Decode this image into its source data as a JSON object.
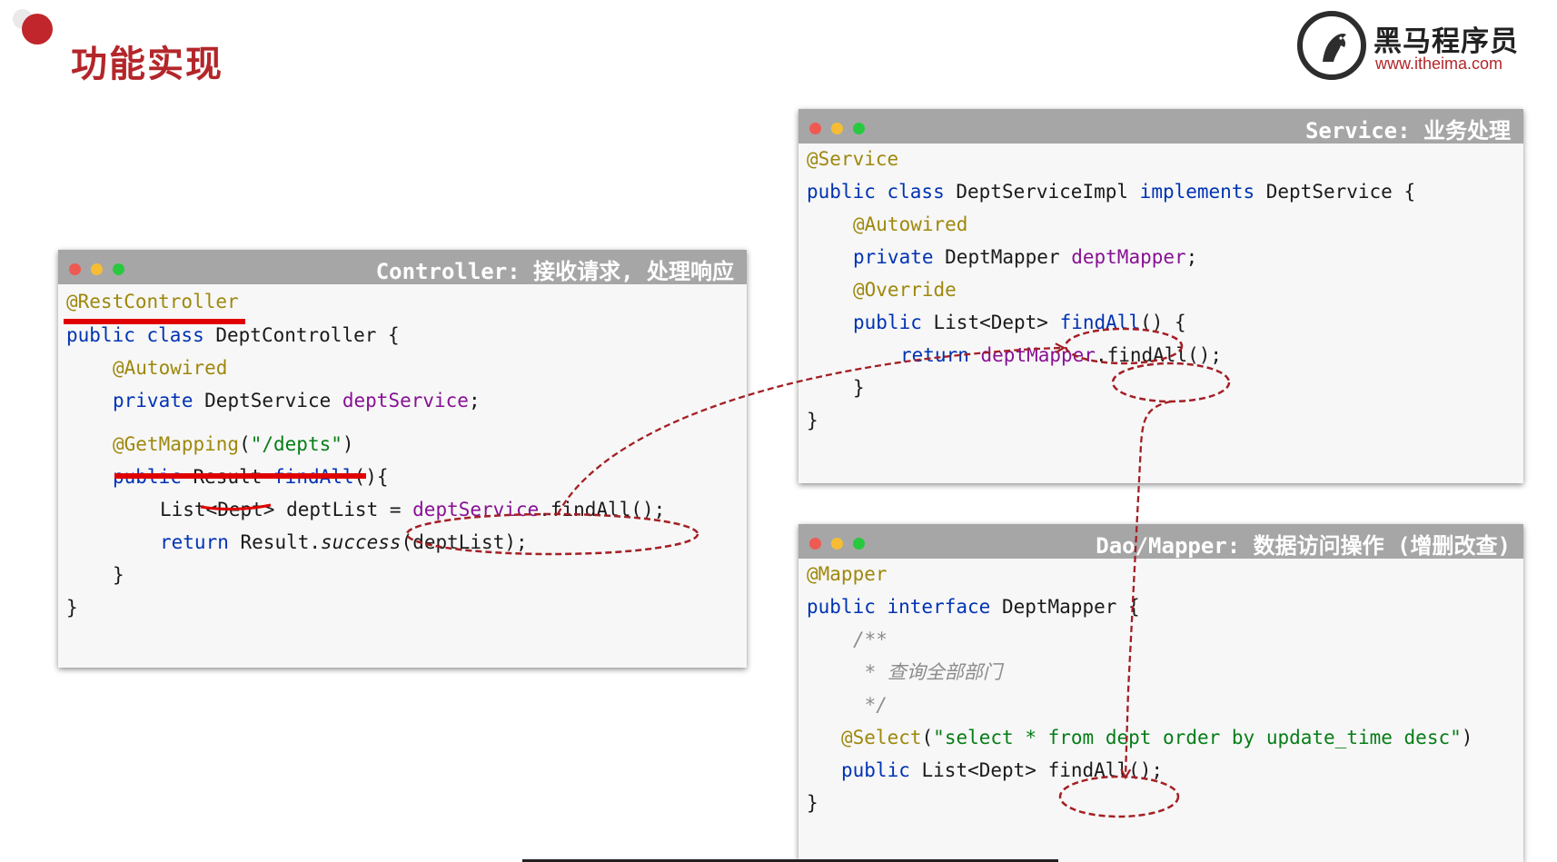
{
  "page": {
    "title": "功能实现"
  },
  "logo": {
    "name_cn": "黑马程序员",
    "url": "www.itheima.com"
  },
  "windows": {
    "controller": {
      "title": "Controller: 接收请求, 处理响应",
      "lines": {
        "l1_ann": "@RestController",
        "l2_kw": "public class ",
        "l2_rest": "DeptController {",
        "l3_ann": "@Autowired",
        "l4_kw": "private ",
        "l4_type": "DeptService ",
        "l4_fld": "deptService",
        "l4_end": ";",
        "l5_ann": "@GetMapping",
        "l5_p1": "(",
        "l5_str": "\"/depts\"",
        "l5_p2": ")",
        "l6_kw": "public ",
        "l6_type": "Result ",
        "l6_kw2": "findAll",
        "l6_end": "(){",
        "l7_pre": "List<Dept> deptList = ",
        "l7_fld": "deptService",
        "l7_end": ".findAll();",
        "l8_kw": "return ",
        "l8_pre": "Result.",
        "l8_it": "success",
        "l8_end": "(deptList);",
        "l9": "}",
        "l10": "}"
      }
    },
    "service": {
      "title": "Service: 业务处理",
      "lines": {
        "l1_ann": "@Service",
        "l2_kw": "public class ",
        "l2_mid": "DeptServiceImpl ",
        "l2_kw2": "implements ",
        "l2_end": "DeptService {",
        "l3_ann": "@Autowired",
        "l4_kw": "private ",
        "l4_type": "DeptMapper ",
        "l4_fld": "deptMapper",
        "l4_end": ";",
        "l5_ann": "@Override",
        "l6_kw": "public ",
        "l6_type": "List<Dept> ",
        "l6_m": "findAll",
        "l6_end": "() {",
        "l7_kw": "return ",
        "l7_fld": "deptMapper",
        "l7_end": ".findAll();",
        "l8": "}",
        "l9": "}"
      }
    },
    "mapper": {
      "title": "Dao/Mapper: 数据访问操作 (增删改查)",
      "lines": {
        "l1_ann": "@Mapper",
        "l2_kw": "public interface ",
        "l2_end": "DeptMapper {",
        "l3_cmt": "/**",
        "l4_cmt": " * 查询全部部门",
        "l5_cmt": " */",
        "l6_ann": "@Select",
        "l6_p1": "(",
        "l6_str": "\"select * from dept order by update_time desc\"",
        "l6_p2": ")",
        "l7_kw": "public ",
        "l7_type": "List<Dept> ",
        "l7_end": "findAll();",
        "l8": "}"
      }
    }
  },
  "colors": {
    "title_red": "#b3262a",
    "annotation_red": "#e00000",
    "dashed_arrow": "#a31f24",
    "titlebar": "#a6a6a6"
  }
}
